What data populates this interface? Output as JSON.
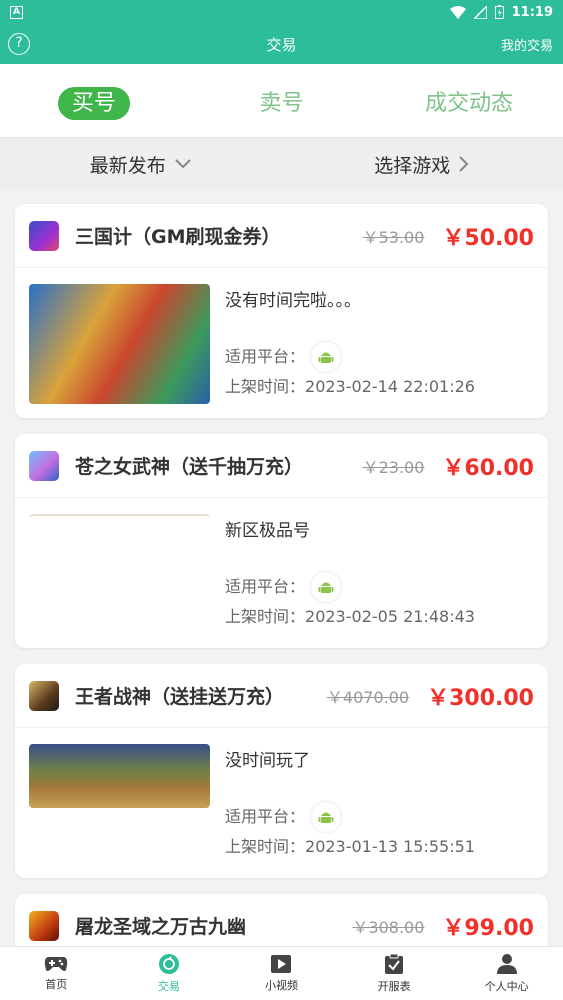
{
  "status": {
    "time": "11:19"
  },
  "header": {
    "title": "交易",
    "right_link": "我的交易",
    "help": "?"
  },
  "tabs": [
    {
      "label": "买号",
      "active": true
    },
    {
      "label": "卖号",
      "active": false
    },
    {
      "label": "成交动态",
      "active": false
    }
  ],
  "filters": {
    "sort": "最新发布",
    "game": "选择游戏"
  },
  "listings": [
    {
      "title": "三国计（GM刷现金券）",
      "old_price": "￥53.00",
      "price": "￥50.00",
      "desc": "没有时间完啦。。。",
      "platform_label": "适用平台：",
      "time_label": "上架时间：",
      "time": "2023-02-14 22:01:26"
    },
    {
      "title": "苍之女武神（送千抽万充）",
      "old_price": "￥23.00",
      "price": "￥60.00",
      "desc": "新区极品号",
      "platform_label": "适用平台：",
      "time_label": "上架时间：",
      "time": "2023-02-05 21:48:43"
    },
    {
      "title": "王者战神（送挂送万充）",
      "old_price": "￥4070.00",
      "price": "￥300.00",
      "desc": "没时间玩了",
      "platform_label": "适用平台：",
      "time_label": "上架时间：",
      "time": "2023-01-13 15:55:51"
    },
    {
      "title": "屠龙圣域之万古九幽",
      "old_price": "￥308.00",
      "price": "￥99.00"
    }
  ],
  "nav": [
    {
      "label": "首页",
      "icon": "gamepad-icon"
    },
    {
      "label": "交易",
      "icon": "trade-icon",
      "active": true
    },
    {
      "label": "小视频",
      "icon": "video-icon"
    },
    {
      "label": "开服表",
      "icon": "clipboard-icon"
    },
    {
      "label": "个人中心",
      "icon": "user-icon"
    }
  ],
  "colors": {
    "brand": "#2ebd9a",
    "tab_active": "#3fb54a",
    "price": "#f2302a"
  }
}
